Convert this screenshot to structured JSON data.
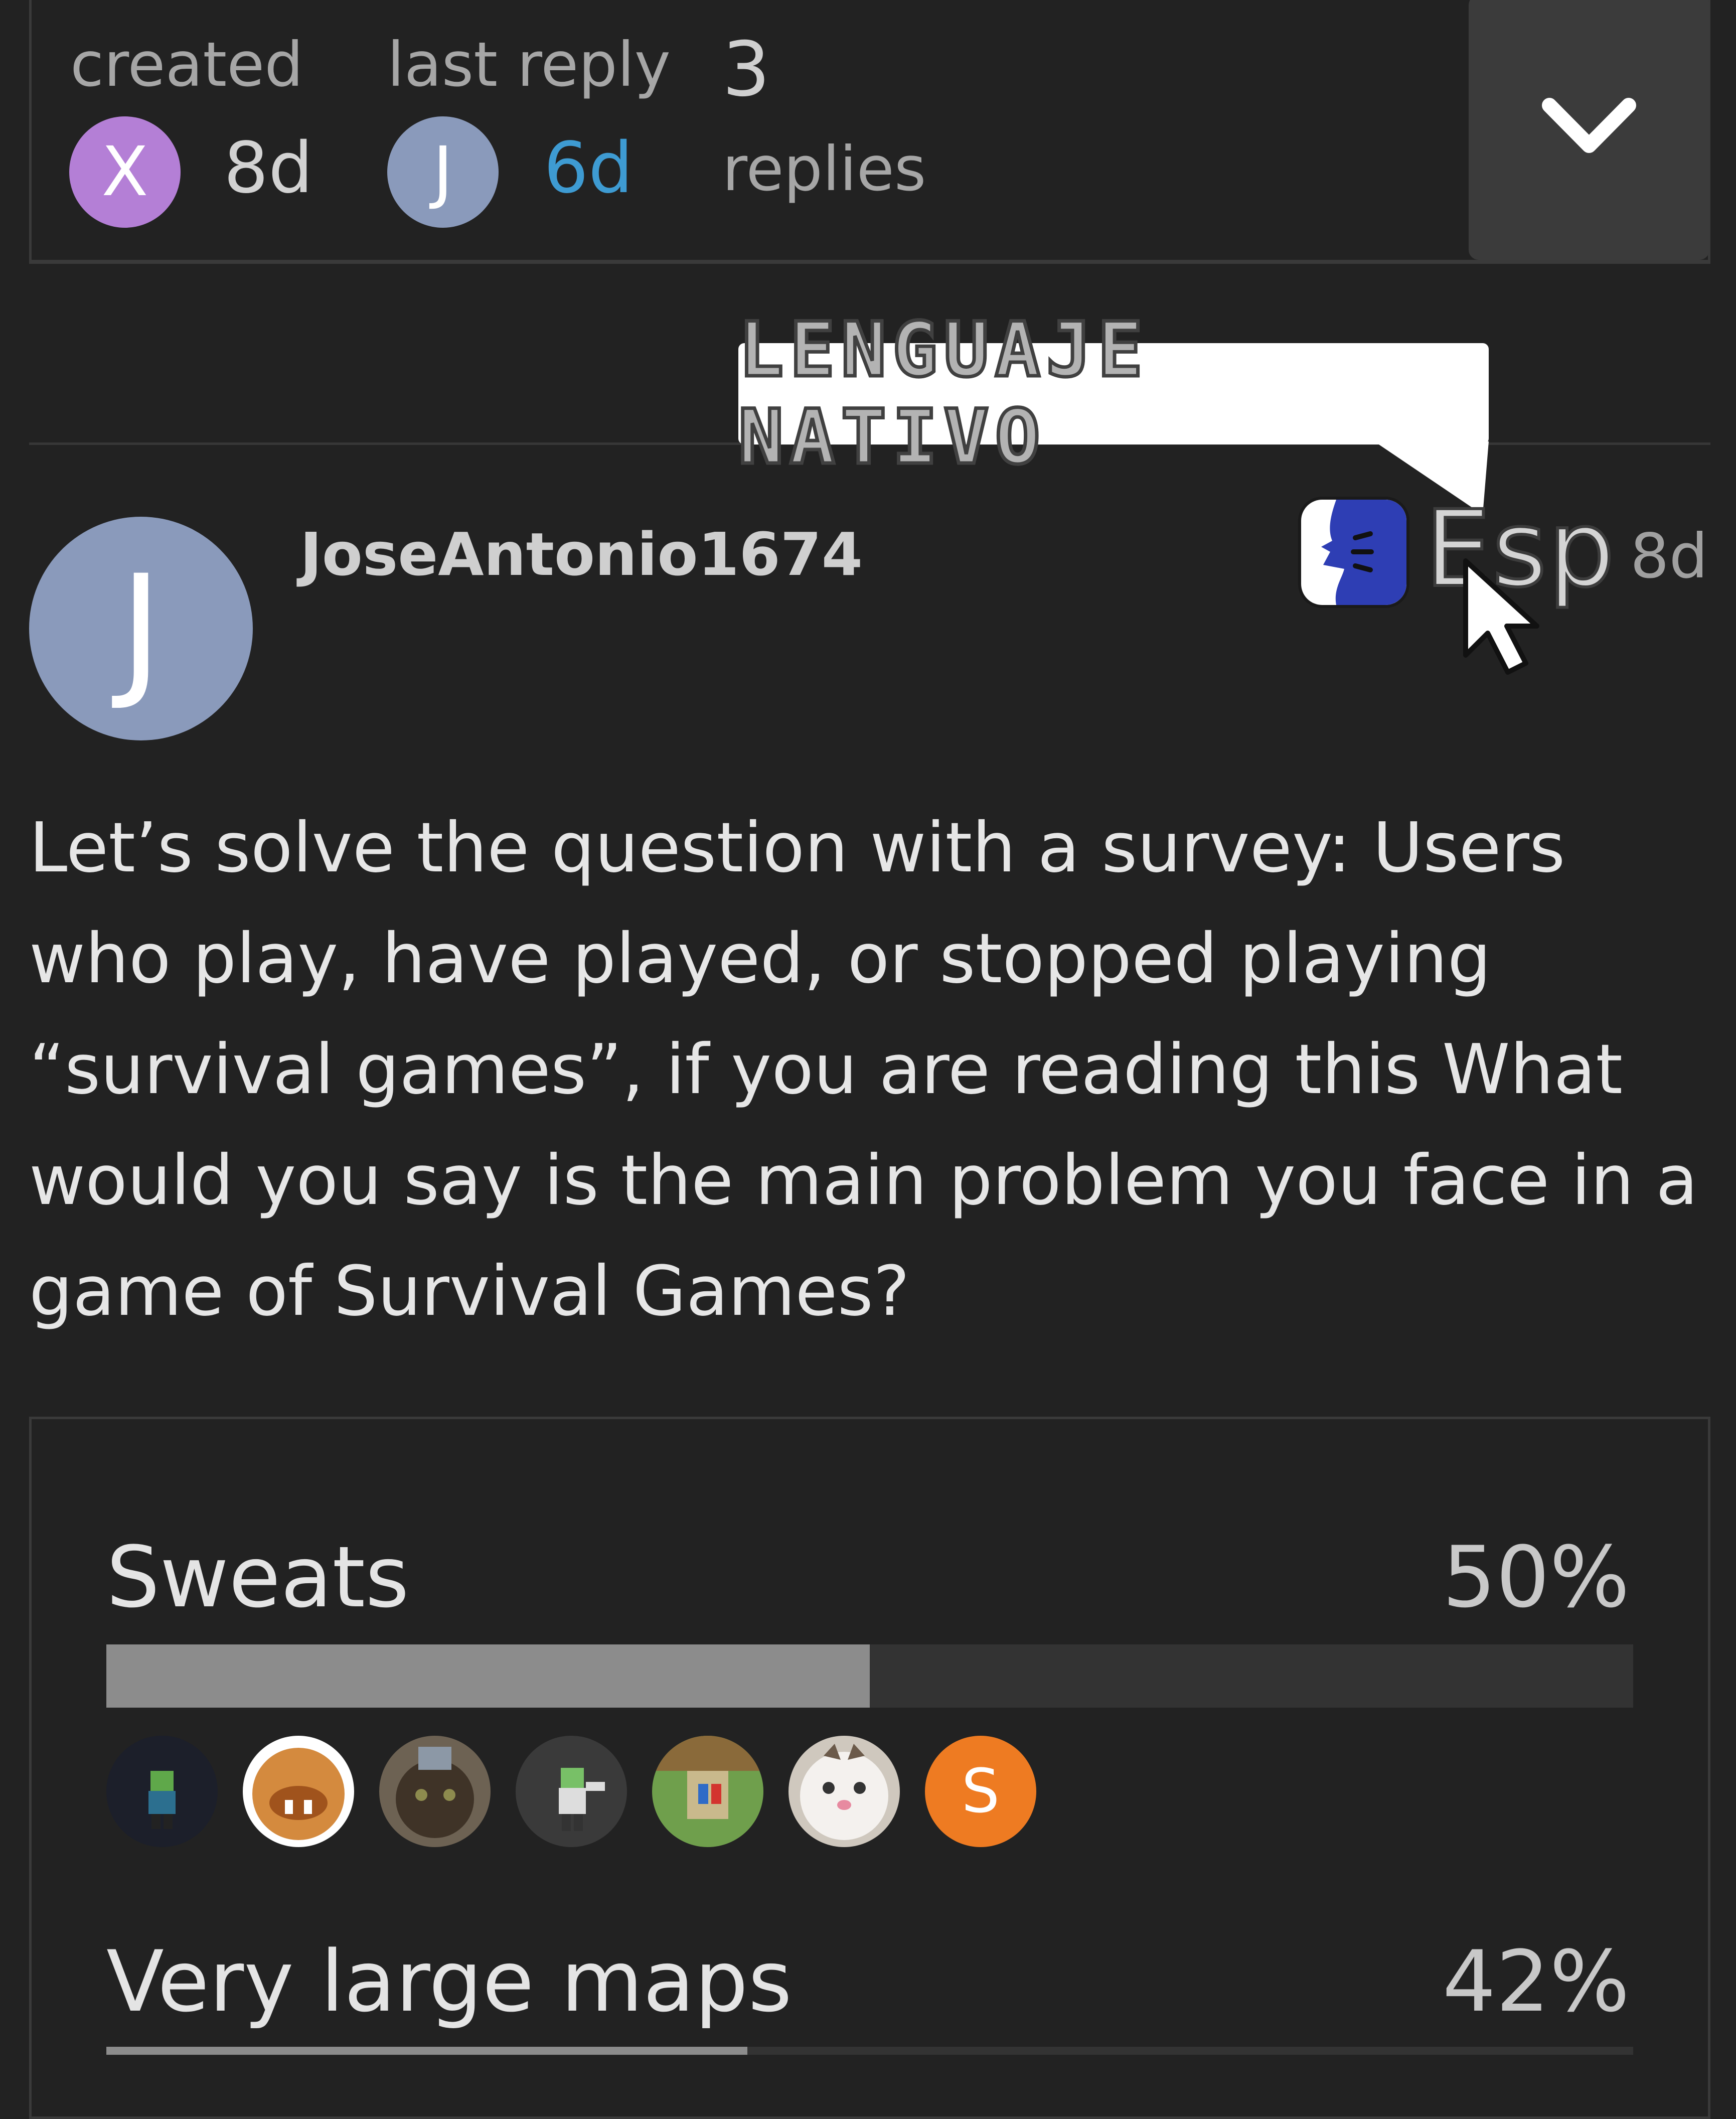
{
  "topic_meta": {
    "created_label": "created",
    "created_avatar_letter": "X",
    "created_time": "8d",
    "last_reply_label": "last reply",
    "last_reply_avatar_letter": "J",
    "last_reply_time": "6d",
    "reply_count": "3",
    "replies_label": "replies",
    "expand_icon": "chevron-down-icon"
  },
  "overlay": {
    "sticker_text": "LENGUAJE NATIVO",
    "lang_label": "Esp"
  },
  "post": {
    "avatar_letter": "J",
    "username": "JoseAntonio1674",
    "time": "8d",
    "body": "Let’s solve the question with a survey: Users who play, have played, or stopped playing “survival games”, if you are reading this What would you say is the main problem you face in a game of Survival Games?"
  },
  "poll": {
    "options": [
      {
        "label": "Sweats",
        "percent": "50%",
        "fraction": 0.5
      },
      {
        "label": "Very large maps",
        "percent": "42%",
        "fraction": 0.42
      }
    ],
    "voters_letter": "S"
  },
  "colors": {
    "background": "#222222",
    "link_blue": "#3e9bd2",
    "avatar_purple": "#b47fd6",
    "avatar_slate": "#8a9abb",
    "bar_fill": "#8c8c8c",
    "bar_track": "#333333",
    "voter_orange": "#ee7b22",
    "translate_blue": "#2e3eb4"
  }
}
